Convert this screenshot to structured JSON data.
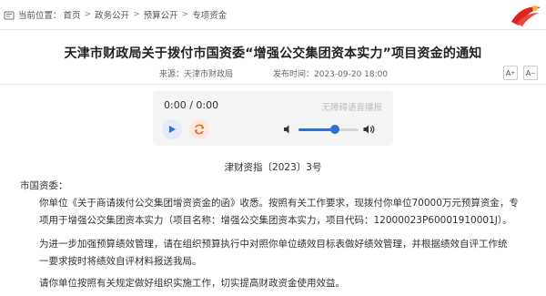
{
  "breadcrumb": {
    "prefix": "当前位置：",
    "items": [
      "首页",
      "政务公开",
      "预算公开",
      "专项资金"
    ],
    "separator": ">"
  },
  "article": {
    "title": "天津市财政局关于拨付市国资委“增强公交集团资本实力”项目资金的通知",
    "source": "来源：天津市财政局",
    "published": "发布时间：2023-09-20 18:00",
    "font_bigger": "A",
    "font_smaller": "A"
  },
  "audio": {
    "time": "0:00 / 0:00",
    "assist_label": "无障碍语音播报",
    "volume_fraction": 0.6
  },
  "document": {
    "number": "津财资指〔2023〕3号",
    "salutation": "市国资委：",
    "p1_lines": [
      "你单位《关于商请拨付公交集团增资资金的函》收悉。按照有关工作要求，现拨付你单位70000万元预算资金，专",
      "项用于增强公交集团资本实力（项目名称：增强公交集团资本实力，项目代码：12000023P60001910001J）。"
    ],
    "p2_lines": [
      "为进一步加强预算绩效管理，请在组织预算执行中对照你单位绩效目标表做好绩效管理，并根据绩效自评工作统",
      "一要求按时将绩效自评材料报送我局。"
    ],
    "p3_lines": [
      "请你单位按照有关规定做好组织实施工作，切实提高财政资金使用效益。"
    ]
  },
  "colors": {
    "accent": "#2f6fd0",
    "loop": "#e86a2f",
    "logo_red": "#d7261e",
    "logo_gold": "#f2b632"
  }
}
